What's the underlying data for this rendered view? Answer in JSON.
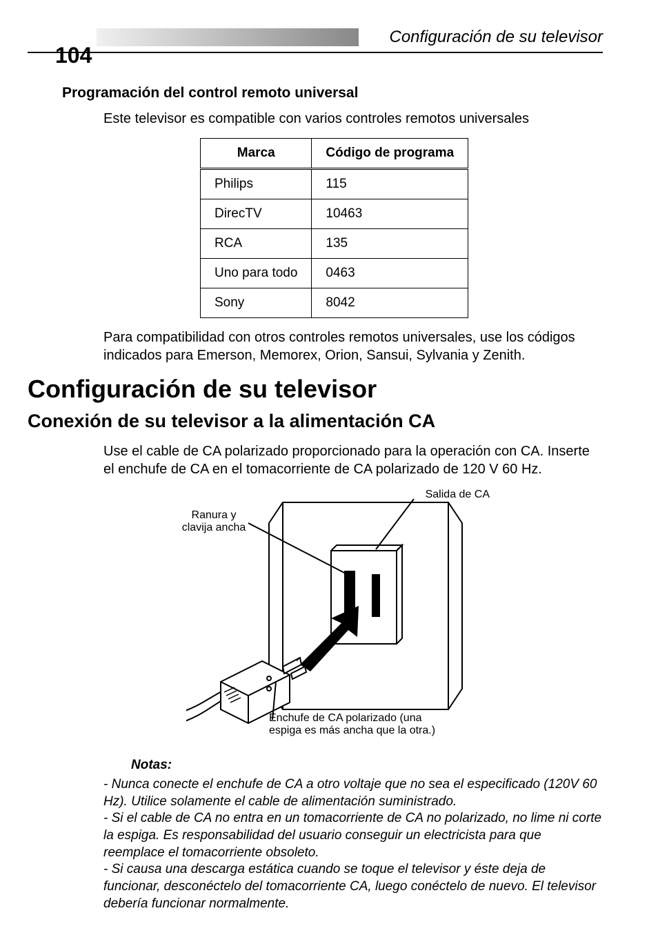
{
  "page_number": "104",
  "header_title": "Configuración de su televisor",
  "section": {
    "heading": "Programación del control remoto universal",
    "intro": "Este televisor es compatible con varios controles remotos universales",
    "table": {
      "headers": [
        "Marca",
        "Código de programa"
      ],
      "rows": [
        {
          "brand": "Philips",
          "code": "115"
        },
        {
          "brand": "DirecTV",
          "code": "10463"
        },
        {
          "brand": "RCA",
          "code": "135"
        },
        {
          "brand": "Uno para todo",
          "code": "0463"
        },
        {
          "brand": "Sony",
          "code": "8042"
        }
      ]
    },
    "after_table": "Para compatibilidad con otros controles remotos universales, use los códigos indicados para Emerson, Memorex, Orion, Sansui, Sylvania y Zenith."
  },
  "main_heading": "Configuración de su televisor",
  "sub_heading": "Conexión de su televisor a la alimentación CA",
  "connection_text": "Use el cable de CA polarizado proporcionado para la operación con CA. Inserte el enchufe de CA en el tomacorriente de CA polarizado de 120 V 60 Hz.",
  "diagram": {
    "label_outlet": "Salida de CA",
    "label_slot": "Ranura y clavija ancha",
    "label_plug": "Enchufe de CA polarizado (una espiga es más ancha que la otra.)"
  },
  "notes": {
    "heading": "Notas:",
    "items": [
      "- Nunca conecte el enchufe de CA a otro voltaje que no sea el especificado (120V 60 Hz). Utilice solamente el cable de alimentación suministrado.",
      "- Si el cable de CA no entra en un tomacorriente de CA no polarizado, no lime ni corte la espiga. Es responsabilidad del usuario conseguir un electricista para que reemplace el tomacorriente obsoleto.",
      "- Si causa una descarga estática cuando se toque el televisor y éste deja de funcionar, desconéctelo del tomacorriente CA, luego conéctelo de nuevo. El televisor debería funcionar normalmente."
    ]
  }
}
